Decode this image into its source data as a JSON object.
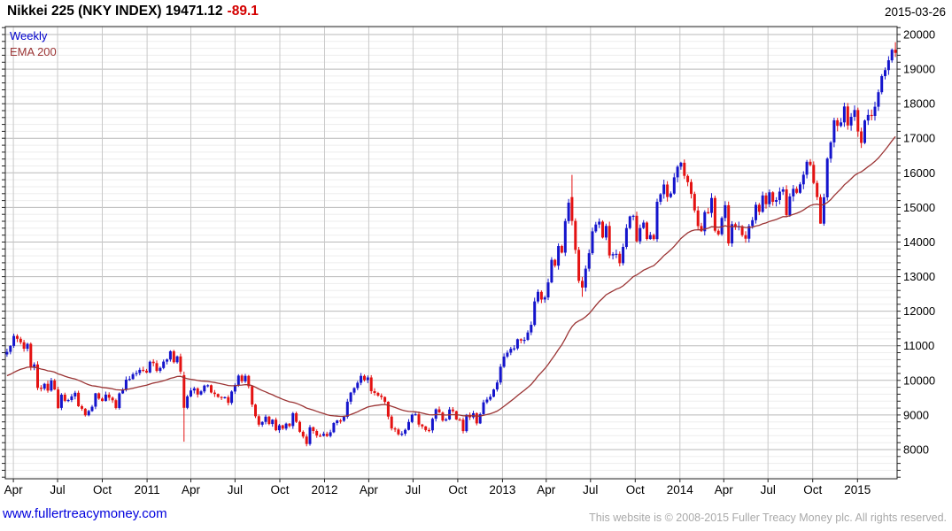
{
  "header": {
    "title": "Nikkei 225 (NKY INDEX) 19471.12",
    "change": "-89.1",
    "date": "2015-03-26"
  },
  "legend": {
    "series1": "Weekly",
    "series2": "EMA 200"
  },
  "footer": {
    "link": "www.fullertreacymoney.com",
    "copyright": "This website is © 2008-2015 Fuller Treacy Money plc. All rights reserved."
  },
  "colors": {
    "up": "#1414cc",
    "down": "#e41212",
    "ema": "#9b3434",
    "title_change": "#d40000",
    "link": "#0000dd",
    "legend_weekly": "#0000cc",
    "grid_minor": "#ededed",
    "grid_major": "#b9b9b9",
    "grid_vertical": "#c9c9c9",
    "frame": "#222222",
    "axis_text": "#000000",
    "copyright": "#a9a9a9"
  },
  "chart_data": {
    "type": "candlestick",
    "title": "Nikkei 225 (NKY INDEX)",
    "interval": "Weekly",
    "last_price": 19471.12,
    "change": -89.1,
    "as_of": "2015-03-26",
    "ylim": [
      7155,
      20230
    ],
    "y_tick_min": 8000,
    "y_tick_max": 20000,
    "y_tick_step": 1000,
    "y_minor_step": 200,
    "grid": "on",
    "x_ticks": [
      "Apr",
      "Jul",
      "Oct",
      "2011",
      "Apr",
      "Jul",
      "Oct",
      "2012",
      "Apr",
      "Jul",
      "Oct",
      "2013",
      "Apr",
      "Jul",
      "Oct",
      "2014",
      "Apr",
      "Jul",
      "Oct",
      "2015"
    ],
    "x_tick_dates": [
      "2010-04-01",
      "2010-07-01",
      "2010-10-01",
      "2011-01-01",
      "2011-04-01",
      "2011-07-01",
      "2011-10-01",
      "2012-01-01",
      "2012-04-01",
      "2012-07-01",
      "2012-10-01",
      "2013-01-01",
      "2013-04-01",
      "2013-07-01",
      "2013-10-01",
      "2014-01-01",
      "2014-04-01",
      "2014-07-01",
      "2014-10-01",
      "2015-01-01"
    ],
    "start_week_ending": "2010-03-19",
    "first_open": 10750,
    "weekly_closes": [
      10824,
      10996,
      11286,
      11204,
      11102,
      10914,
      11057,
      10365,
      10462,
      9785,
      9762,
      9901,
      9705,
      9995,
      9737,
      9203,
      9585,
      9408,
      9431,
      9537,
      9642,
      9253,
      9179,
      8991,
      9114,
      9239,
      9626,
      9472,
      9404,
      9589,
      9500,
      9427,
      9202,
      9625,
      9725,
      10022,
      10040,
      10178,
      10212,
      10304,
      10280,
      10229,
      10541,
      10499,
      10275,
      10360,
      10543,
      10605,
      10843,
      10526,
      10694,
      10254,
      9206,
      9536,
      9708,
      9768,
      9591,
      9682,
      9850,
      9859,
      9648,
      9607,
      9522,
      9492,
      9514,
      9351,
      9679,
      9868,
      10138,
      9974,
      10132,
      9833,
      9299,
      8963,
      8719,
      8798,
      8950,
      8738,
      8864,
      8560,
      8700,
      8605,
      8748,
      8679,
      9050,
      8801,
      8514,
      8375,
      8160,
      8644,
      8536,
      8402,
      8395,
      8455,
      8390,
      8500,
      8766,
      8841,
      8831,
      8947,
      9384,
      9647,
      9777,
      9930,
      10130,
      10011,
      10084,
      9688,
      9638,
      9561,
      9520,
      9380,
      8953,
      8611,
      8580,
      8440,
      8459,
      8569,
      8798,
      9007,
      9020,
      8724,
      8670,
      8566,
      8555,
      8891,
      9163,
      9070,
      8840,
      8872,
      9159,
      9110,
      8870,
      8863,
      8534,
      9003,
      8933,
      9051,
      8757,
      9024,
      9367,
      9446,
      9527,
      9738,
      9940,
      10395,
      10688,
      10801,
      10913,
      10926,
      11191,
      11153,
      11173,
      11385,
      11606,
      12283,
      12560,
      12338,
      12397,
      12833,
      13485,
      13316,
      13884,
      13694,
      14607,
      15138,
      14612,
      13774,
      12877,
      12686,
      13230,
      13677,
      14310,
      14506,
      14589,
      14130,
      14466,
      13615,
      13650,
      13660,
      13389,
      13860,
      14404,
      14742,
      14760,
      14024,
      14405,
      14562,
      14088,
      14202,
      14086,
      15165,
      15382,
      15662,
      15300,
      15403,
      15870,
      16178,
      16291,
      15912,
      15734,
      15391,
      14914,
      14462,
      14313,
      14865,
      14841,
      15274,
      14328,
      14224,
      14696,
      15064,
      13960,
      14516,
      14429,
      14457,
      14199,
      14097,
      14462,
      14632,
      15077,
      14874,
      15349,
      15095,
      15437,
      15164,
      15215,
      15457,
      15523,
      14778,
      15318,
      15539,
      15424,
      15668,
      15948,
      16321,
      16230,
      15709,
      15300,
      14532,
      15292,
      16413,
      16880,
      17520,
      17358,
      17460,
      17920,
      17371,
      17621,
      17818,
      17197,
      16864,
      17512,
      17674,
      17648,
      17913,
      18332,
      18797,
      18971,
      19254,
      19560,
      19471
    ],
    "ohlc_overrides": {
      "52": [
        10150,
        10254,
        8227,
        9206
      ],
      "166": [
        15300,
        15942,
        14483,
        14612
      ],
      "169": [
        12877,
        12990,
        12415,
        12686
      ],
      "198": [
        16178,
        16320,
        16090,
        16291
      ],
      "239": [
        15300,
        15380,
        14529,
        14532
      ],
      "241": [
        15292,
        16450,
        15200,
        16413
      ],
      "246": [
        17460,
        18030,
        17330,
        17920
      ],
      "261": [
        19560,
        19778,
        19349,
        19471
      ]
    },
    "ema_label": "EMA 200",
    "ema_period_weeks": 40,
    "ema_seed": 10100
  }
}
